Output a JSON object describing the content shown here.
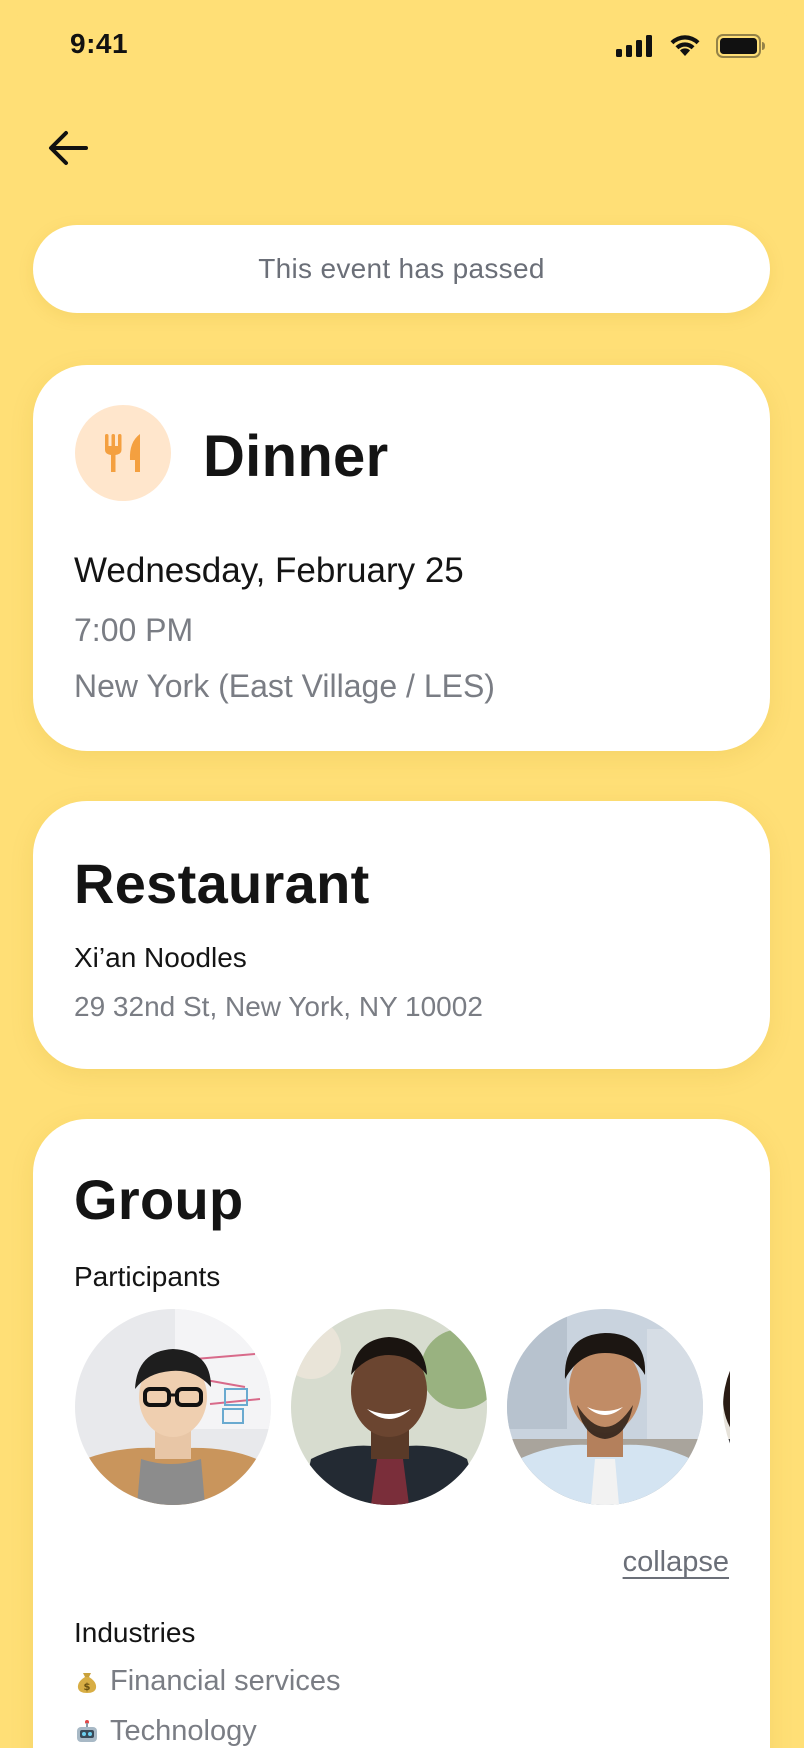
{
  "status_bar": {
    "time": "9:41"
  },
  "banner": {
    "text": "This event has passed"
  },
  "event": {
    "title": "Dinner",
    "date": "Wednesday, February 25",
    "time": "7:00 PM",
    "location": "New York (East Village / LES)",
    "icon": "fork-knife-icon",
    "accent_color": "#F4A040"
  },
  "restaurant": {
    "section_title": "Restaurant",
    "name": "Xi’an Noodles",
    "address": "29 32nd St, New York, NY 10002"
  },
  "group": {
    "section_title": "Group",
    "participants_label": "Participants",
    "participants": [
      {
        "avatar": "participant-avatar-1"
      },
      {
        "avatar": "participant-avatar-2"
      },
      {
        "avatar": "participant-avatar-3"
      },
      {
        "avatar": "participant-avatar-4"
      }
    ],
    "collapse_label": "collapse",
    "industries_label": "Industries",
    "industries": [
      {
        "emoji": "💰",
        "icon": "money-bag-icon",
        "label": "Financial services"
      },
      {
        "emoji": "🤖",
        "icon": "robot-icon",
        "label": "Technology"
      }
    ]
  },
  "colors": {
    "background": "#FFDF76",
    "card": "#FFFFFF",
    "muted_text": "#7A7D84"
  }
}
